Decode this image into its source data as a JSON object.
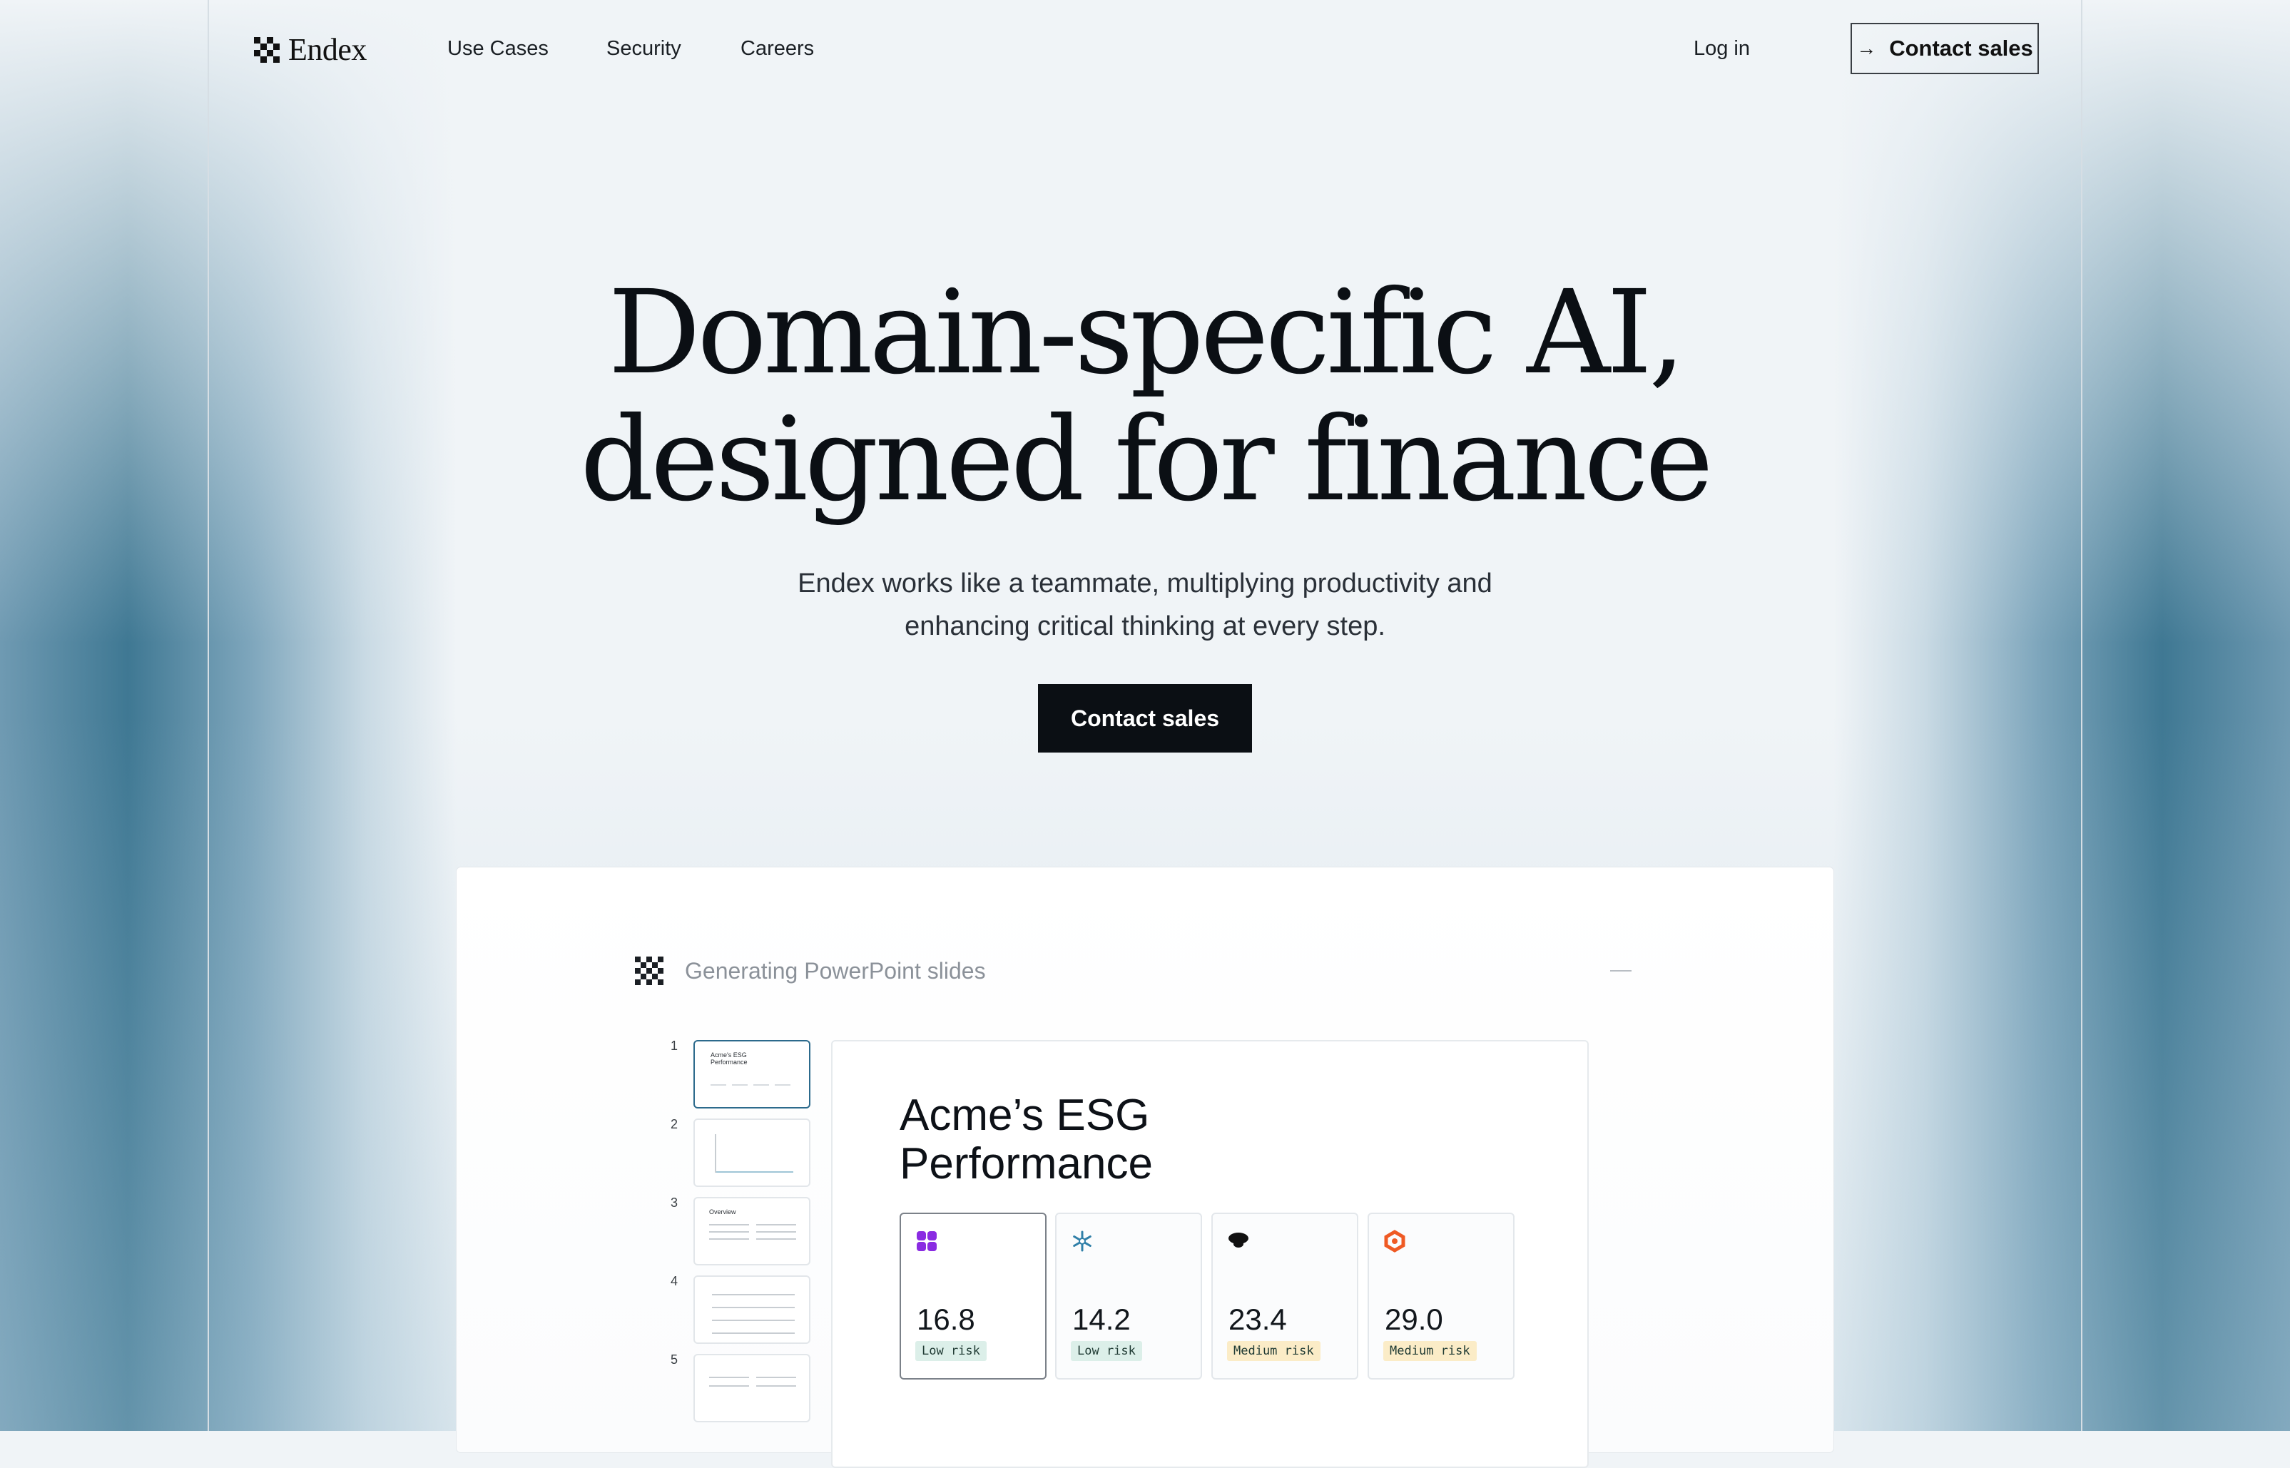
{
  "brand": {
    "name": "Endex"
  },
  "nav": {
    "links": [
      "Use Cases",
      "Security",
      "Careers"
    ],
    "login": "Log in",
    "contact_sales": "Contact sales",
    "contact_icon": "arrow-right-icon"
  },
  "hero": {
    "title_line1": "Domain-specific AI,",
    "title_line2": "designed for finance",
    "subtitle_line1": "Endex works like a teammate, multiplying productivity and",
    "subtitle_line2": "enhancing critical thinking at every step.",
    "cta": "Contact sales"
  },
  "demo": {
    "status": "Generating PowerPoint slides",
    "collapse_icon": "minus-icon",
    "thumbnails": [
      {
        "number": "1",
        "label": "Acme's ESG Performance",
        "active": true
      },
      {
        "number": "2",
        "label": ""
      },
      {
        "number": "3",
        "label": "Overview"
      },
      {
        "number": "4",
        "label": ""
      },
      {
        "number": "5",
        "label": ""
      }
    ],
    "slide": {
      "title_line1": "Acme’s ESG",
      "title_line2": "Performance",
      "metrics": [
        {
          "value": "16.8",
          "badge": "Low risk",
          "icon": "purple-quad-logo-icon",
          "color": "#8a2be2"
        },
        {
          "value": "14.2",
          "badge": "Low risk",
          "icon": "snowflake-logo-icon",
          "color": "#2f7fa8"
        },
        {
          "value": "23.4",
          "badge": "Medium risk",
          "icon": "black-dome-logo-icon",
          "color": "#111111"
        },
        {
          "value": "29.0",
          "badge": "Medium risk",
          "icon": "orange-hexagon-logo-icon",
          "color": "#ef5a24"
        }
      ]
    }
  },
  "colors": {
    "background": "#f0f4f7",
    "primary_button": "#0b0f14",
    "accent_teal": "#3f7893",
    "low_risk_bg": "#dcefe9",
    "medium_risk_bg": "#fbecc7"
  }
}
